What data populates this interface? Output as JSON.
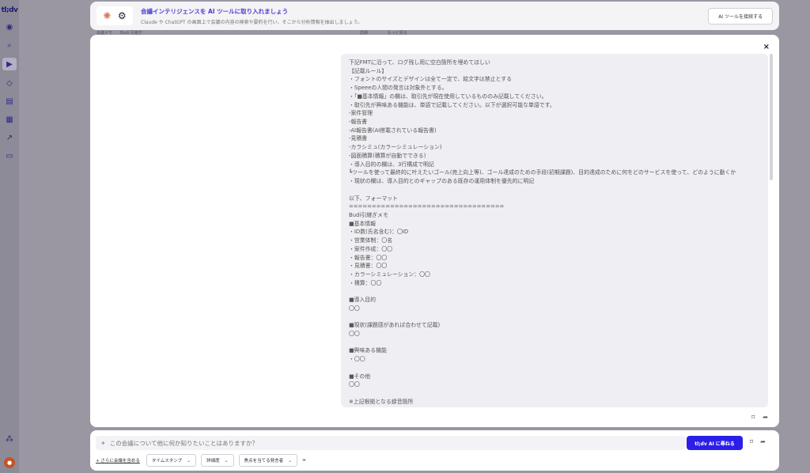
{
  "sidebar": {
    "logo": "tl;dv",
    "icons": [
      "record-icon",
      "search-icon",
      "video-icon",
      "tag-icon",
      "notes-icon",
      "apps-icon",
      "chart-icon",
      "library-icon"
    ],
    "bottom_icons": [
      "invite-icon",
      "avatar"
    ]
  },
  "banner": {
    "title": "会議インテリジェンスを AI ツールに取り入れましょう",
    "subtitle": "Claude や ChatGPT の画面上で会議の内容の検索や要約を行い、そこから分析情報を抽出しましょう。",
    "connect_label": "AI ツールを接続する"
  },
  "behind": {
    "text": "会議メモ　　Budi 引継ぎ　　　　　　　　　　　　　　　　　　　　　　　　　　　　　　　　　　　　　　　　　　　　　　　　　　　　　　　詳細　　　　　もっと見る"
  },
  "modal": {
    "close_label": "×",
    "message_lines": [
      "下記FMTに沿って、ログ残し用に空白箇所を埋めてほしい",
      "【記載ルール】",
      "・フォントのサイズとデザインは全て一定で、絵文字は禁止とする",
      "・Speeeの人間の発言は対象外とする。",
      "・「■基本情報」の欄は、取引先が現在使用しているもののみ記載してください。",
      "・取引先が興味ある機能は、単語で記載してください。以下が選択可能な単語です。",
      "-案件管理",
      "-報告書",
      "-AI報告書(AI搭載されている報告書)",
      "-見積書",
      "-カラシミュ(カラーシミュレーション)",
      "-図面積算(積算が自動でできる)",
      "・導入目的の欄は、3行構成で明記",
      "┗ツールを使って最終的に叶えたいゴール(売上向上等)、ゴール達成のための手段(初期課題)、目的達成のために何をどのサービスを使って、どのように動くか",
      "・現状の欄は、導入目的とのギャップのある既存の運用体制を優先的に明記",
      "",
      "以下、フォーマット",
      "==================================",
      "Budi引継ぎメモ",
      "■基本情報",
      "・ID数(氏名含む)：〇ID",
      "・営業体制：〇名",
      "・案件作成：〇〇",
      "・報告書：〇〇",
      "・見積書：〇〇",
      "・カラーシミュレーション：〇〇",
      "・積算：〇〇",
      "",
      "■導入目的",
      "〇〇",
      "",
      "■現状(課題感があれば合わせて記載)",
      "〇〇",
      "",
      "■興味ある機能",
      "・〇〇",
      "",
      "■その他",
      "〇〇",
      "",
      "※上記根拠となる録音箇所"
    ]
  },
  "chat": {
    "placeholder": "この会議について他に何か知りたいことはありますか？",
    "ask_label": "tl;dv AI に尋ねる",
    "more_link": "+ さらに会議を含める",
    "filters": [
      "タイムスタンプ",
      "詳細度",
      "焦点を当てる発言者"
    ]
  }
}
